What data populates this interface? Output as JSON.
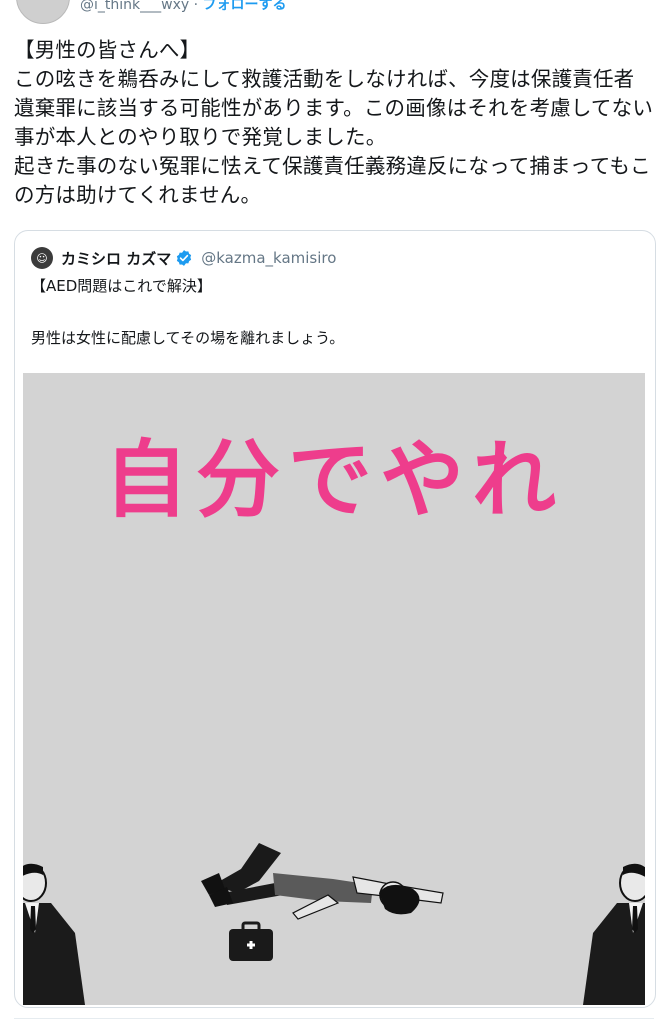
{
  "header": {
    "handle": "@i_think___wxy",
    "separator": "·",
    "follow_label": "フォローする"
  },
  "tweet": {
    "text": "【男性の皆さんへ】\nこの呟きを鵜呑みにして救護活動をしなければ、今度は保護責任者遺棄罪に該当する可能性があります。この画像はそれを考慮してない事が本人とのやり取りで発覚しました。\n起きた事のない冤罪に怯えて保護責任義務違反になって捕まってもこの方は助けてくれません。"
  },
  "quote": {
    "name": "カミシロ カズマ",
    "handle": "@kazma_kamisiro",
    "line1": "【AED問題はこれで解決】",
    "line2": "男性は女性に配慮してその場を離れましょう。",
    "image_title": "自分でやれ"
  },
  "colors": {
    "accent": "#1d9bf0",
    "image_title": "#ee3d8c",
    "image_bg": "#d3d3d3",
    "handle_gray": "#657786"
  },
  "icons": [
    "avatar",
    "verified-badge-icon",
    "aed-case-icon"
  ]
}
